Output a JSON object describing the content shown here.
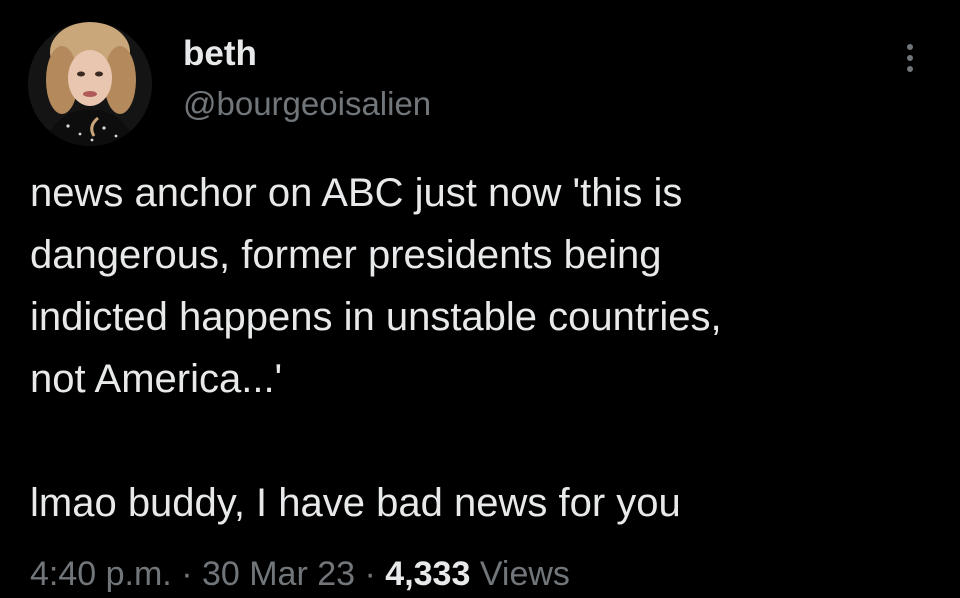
{
  "author": {
    "display_name": "beth",
    "handle": "@bourgeoisalien"
  },
  "icons": {
    "more": "more-vertical-icon",
    "avatar": "profile-photo"
  },
  "tweet": {
    "lines": [
      "news anchor on ABC just now 'this is",
      "dangerous, former presidents being",
      "indicted happens in unstable countries,",
      "not America...'",
      "lmao buddy, I have bad news for you"
    ]
  },
  "meta": {
    "time": "4:40 p.m.",
    "separator_1": " · ",
    "date": "30 Mar 23",
    "separator_2": " · ",
    "views_count": "4,333",
    "views_label": " Views"
  },
  "colors": {
    "background": "#000000",
    "primary_text": "#e7e9ea",
    "secondary_text": "#71767b"
  }
}
